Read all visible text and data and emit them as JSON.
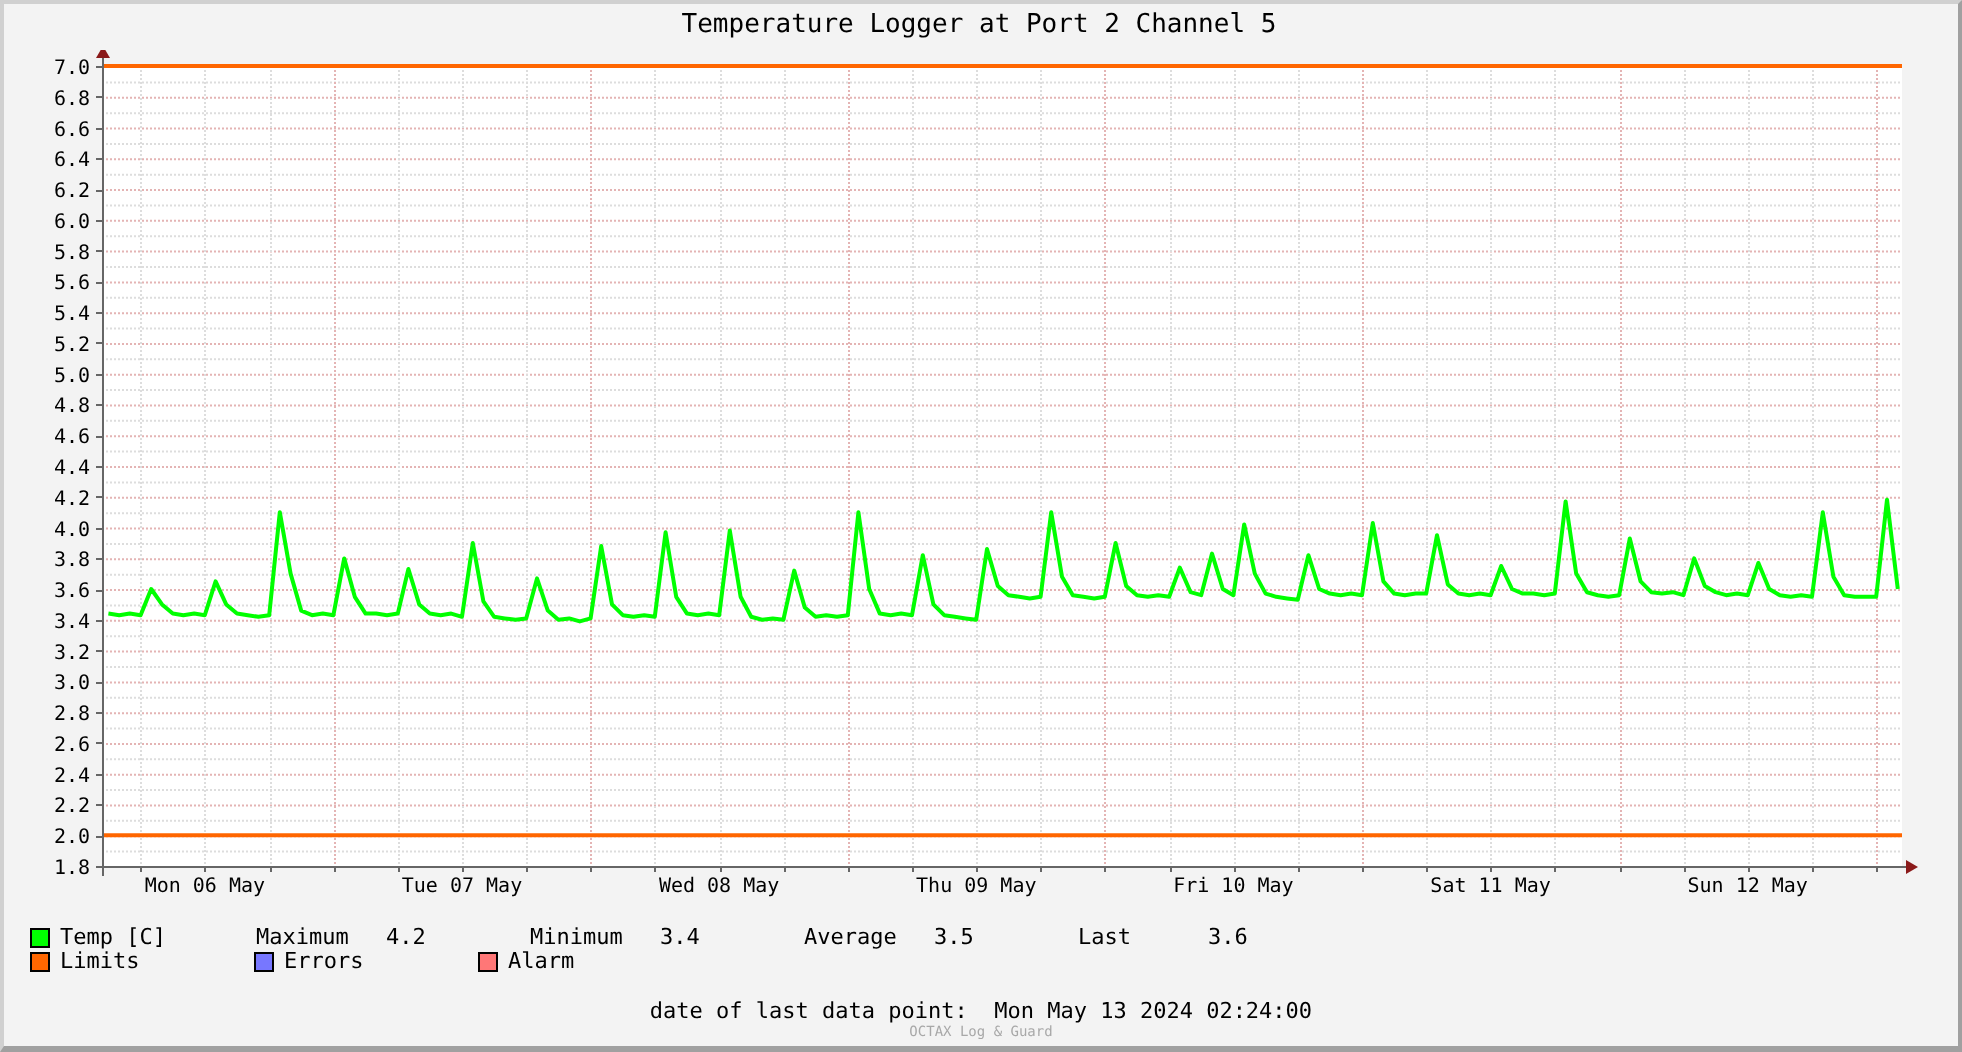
{
  "graph": {
    "chart_data": {
      "type": "line",
      "title": "Temperature Logger at Port 2 Channel 5",
      "categories": [
        null,
        null,
        null,
        null,
        null,
        null,
        null,
        null,
        null,
        "Mon 06 May",
        null,
        null,
        null,
        null,
        null,
        null,
        null,
        null,
        null,
        null,
        null,
        null,
        null,
        null,
        null,
        null,
        null,
        null,
        null,
        null,
        null,
        null,
        null,
        "Tue 07 May",
        null,
        null,
        null,
        null,
        null,
        null,
        null,
        null,
        null,
        null,
        null,
        null,
        null,
        null,
        null,
        null,
        null,
        null,
        null,
        null,
        null,
        null,
        null,
        "Wed 08 May",
        null,
        null,
        null,
        null,
        null,
        null,
        null,
        null,
        null,
        null,
        null,
        null,
        null,
        null,
        null,
        null,
        null,
        null,
        null,
        null,
        null,
        null,
        null,
        "Thu 09 May",
        null,
        null,
        null,
        null,
        null,
        null,
        null,
        null,
        null,
        null,
        null,
        null,
        null,
        null,
        null,
        null,
        null,
        null,
        null,
        null,
        null,
        null,
        null,
        "Fri 10 May",
        null,
        null,
        null,
        null,
        null,
        null,
        null,
        null,
        null,
        null,
        null,
        null,
        null,
        null,
        null,
        null,
        null,
        null,
        null,
        null,
        null,
        null,
        null,
        "Sat 11 May",
        null,
        null,
        null,
        null,
        null,
        null,
        null,
        null,
        null,
        null,
        null,
        null,
        null,
        null,
        null,
        null,
        null,
        null,
        null,
        null,
        null,
        null,
        null,
        "Sun 12 May",
        null,
        null,
        null,
        null,
        null,
        null,
        null,
        null,
        null,
        null,
        null,
        null,
        null,
        null
      ],
      "series": [
        {
          "name": "Temp [C]",
          "color": "#00ff00",
          "values": [
            3.44,
            3.43,
            3.44,
            3.43,
            3.6,
            3.5,
            3.44,
            3.43,
            3.44,
            3.43,
            3.65,
            3.5,
            3.44,
            3.43,
            3.42,
            3.43,
            4.1,
            3.7,
            3.46,
            3.43,
            3.44,
            3.43,
            3.8,
            3.55,
            3.44,
            3.44,
            3.43,
            3.44,
            3.73,
            3.5,
            3.44,
            3.43,
            3.44,
            3.42,
            3.9,
            3.52,
            3.42,
            3.41,
            3.4,
            3.41,
            3.67,
            3.46,
            3.4,
            3.41,
            3.39,
            3.41,
            3.88,
            3.5,
            3.43,
            3.42,
            3.43,
            3.42,
            3.97,
            3.55,
            3.44,
            3.43,
            3.44,
            3.43,
            3.98,
            3.55,
            3.42,
            3.4,
            3.41,
            3.4,
            3.72,
            3.48,
            3.42,
            3.43,
            3.42,
            3.43,
            4.1,
            3.6,
            3.44,
            3.43,
            3.44,
            3.43,
            3.82,
            3.5,
            3.43,
            3.42,
            3.41,
            3.4,
            3.86,
            3.62,
            3.56,
            3.55,
            3.54,
            3.55,
            4.1,
            3.68,
            3.56,
            3.55,
            3.54,
            3.55,
            3.9,
            3.62,
            3.56,
            3.55,
            3.56,
            3.55,
            3.74,
            3.58,
            3.56,
            3.83,
            3.6,
            3.56,
            4.02,
            3.7,
            3.57,
            3.55,
            3.54,
            3.53,
            3.82,
            3.6,
            3.57,
            3.56,
            3.57,
            3.56,
            4.03,
            3.65,
            3.57,
            3.56,
            3.57,
            3.57,
            3.95,
            3.63,
            3.57,
            3.56,
            3.57,
            3.56,
            3.75,
            3.6,
            3.57,
            3.57,
            3.56,
            3.57,
            4.17,
            3.7,
            3.58,
            3.56,
            3.55,
            3.56,
            3.93,
            3.65,
            3.58,
            3.57,
            3.58,
            3.56,
            3.8,
            3.62,
            3.58,
            3.56,
            3.57,
            3.56,
            3.77,
            3.6,
            3.56,
            3.55,
            3.56,
            3.55,
            4.1,
            3.68,
            3.56,
            3.55,
            3.55,
            3.55,
            4.18,
            3.6
          ]
        }
      ],
      "ylim": [
        1.8,
        7.0
      ],
      "yticks": [
        1.8,
        {
          "value": 2,
          "label": "2.0"
        },
        2.2,
        2.4,
        2.6,
        2.8,
        {
          "value": 3,
          "label": "3.0"
        },
        3.2,
        3.4,
        3.6,
        3.8,
        {
          "value": 4,
          "label": "4.0"
        },
        4.2,
        4.4,
        4.6,
        4.8,
        {
          "value": 5,
          "label": "5.0"
        },
        5.2,
        5.4,
        5.6,
        5.8,
        {
          "value": 6,
          "label": "6.0"
        },
        6.2,
        6.4,
        6.6,
        6.8,
        {
          "value": 7,
          "label": "7.0"
        }
      ],
      "grid": true,
      "ref_lines": [
        {
          "axis": "y",
          "value": 7.0,
          "color": "#ff6600"
        },
        {
          "axis": "y",
          "value": 2.0,
          "color": "#ff6600"
        }
      ]
    },
    "stats": [
      {
        "label": "Maximum",
        "value": "4.2"
      },
      {
        "label": "Minimum",
        "value": "3.4"
      },
      {
        "label": "Average",
        "value": "3.5"
      },
      {
        "label": "Last",
        "value": "3.6"
      }
    ],
    "legend": [
      {
        "label": "Limits",
        "color": "#ff6600"
      },
      {
        "label": "Errors",
        "color": "#7777ff"
      },
      {
        "label": "Alarm",
        "color": "#ff7777"
      }
    ],
    "footer": "date of last data point:  Mon May 13 2024 02:24:00",
    "watermark": "OCTAX Log & Guard"
  }
}
